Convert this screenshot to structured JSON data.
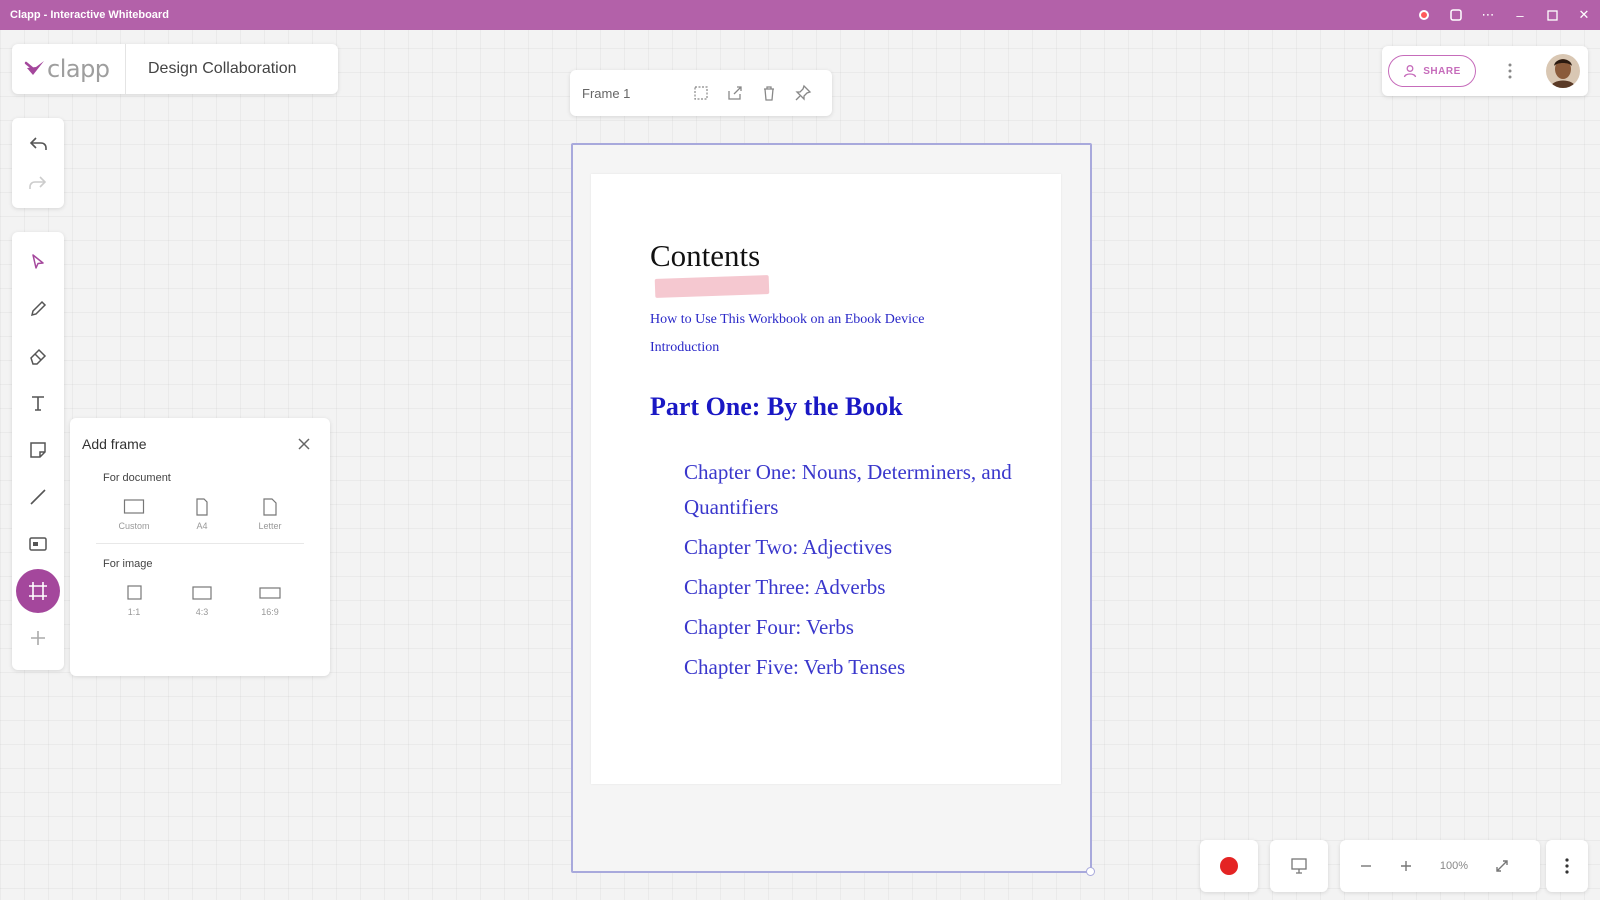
{
  "window": {
    "title": "Clapp - Interactive Whiteboard"
  },
  "header": {
    "logo_text": "clapp",
    "board_name": "Design Collaboration"
  },
  "frame_toolbar": {
    "frame_name": "Frame 1"
  },
  "share": {
    "label": "SHARE"
  },
  "add_frame": {
    "title": "Add frame",
    "document_section": "For document",
    "document_options": [
      "Custom",
      "A4",
      "Letter"
    ],
    "image_section": "For image",
    "image_options": [
      "1:1",
      "4:3",
      "16:9"
    ]
  },
  "document": {
    "title": "Contents",
    "links": [
      "How to Use This Workbook on an Ebook Device",
      "Introduction"
    ],
    "part": "Part One: By the Book",
    "chapters": [
      "Chapter One: Nouns, Determiners, and Quantifiers",
      "Chapter Two: Adjectives",
      "Chapter Three: Adverbs",
      "Chapter Four: Verbs",
      "Chapter Five: Verb Tenses"
    ]
  },
  "zoom": {
    "level": "100%"
  },
  "colors": {
    "titlebar": "#b361a9",
    "accent": "#a4479c",
    "link_blue": "#2a28c8",
    "record_red": "#e42424",
    "frame_outline": "#a8a9dc"
  }
}
